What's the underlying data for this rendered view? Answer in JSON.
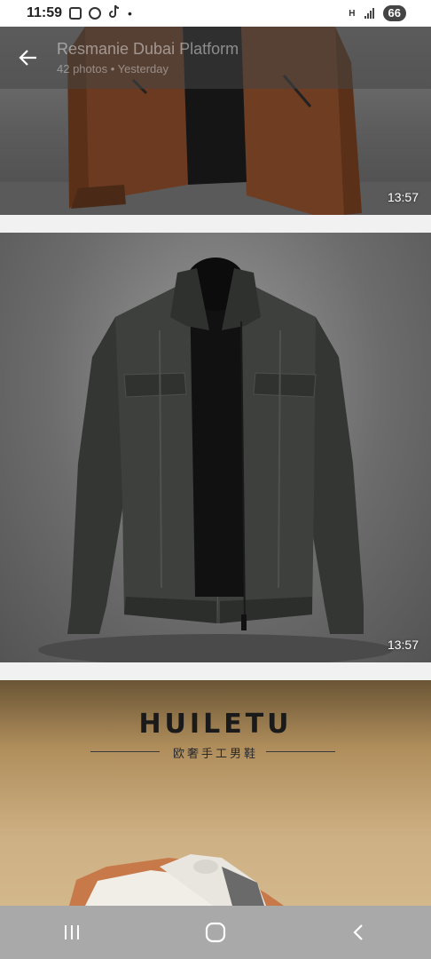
{
  "status_bar": {
    "time": "11:59",
    "icons": [
      "screenshot-icon",
      "whatsapp-icon",
      "tiktok-icon"
    ],
    "dot": "•",
    "network_label": "H",
    "battery": "66"
  },
  "header": {
    "title": "Resmanie Dubai Platform",
    "subtitle": "42 photos • Yesterday"
  },
  "photos": [
    {
      "name": "brown-leather-jacket",
      "time": "13:57"
    },
    {
      "name": "dark-leather-jacket",
      "time": "13:57"
    },
    {
      "name": "huiletu-shoe-box",
      "brand": "HUILETU",
      "brand_sub": "欧奢手工男鞋"
    }
  ],
  "nav": {
    "recents_icon": "recents-icon",
    "home_icon": "home-icon",
    "back_icon": "back-icon"
  },
  "colors": {
    "status_bg": "#ffffff",
    "nav_bg": "#a9a9a9",
    "header_overlay": "#464646"
  }
}
